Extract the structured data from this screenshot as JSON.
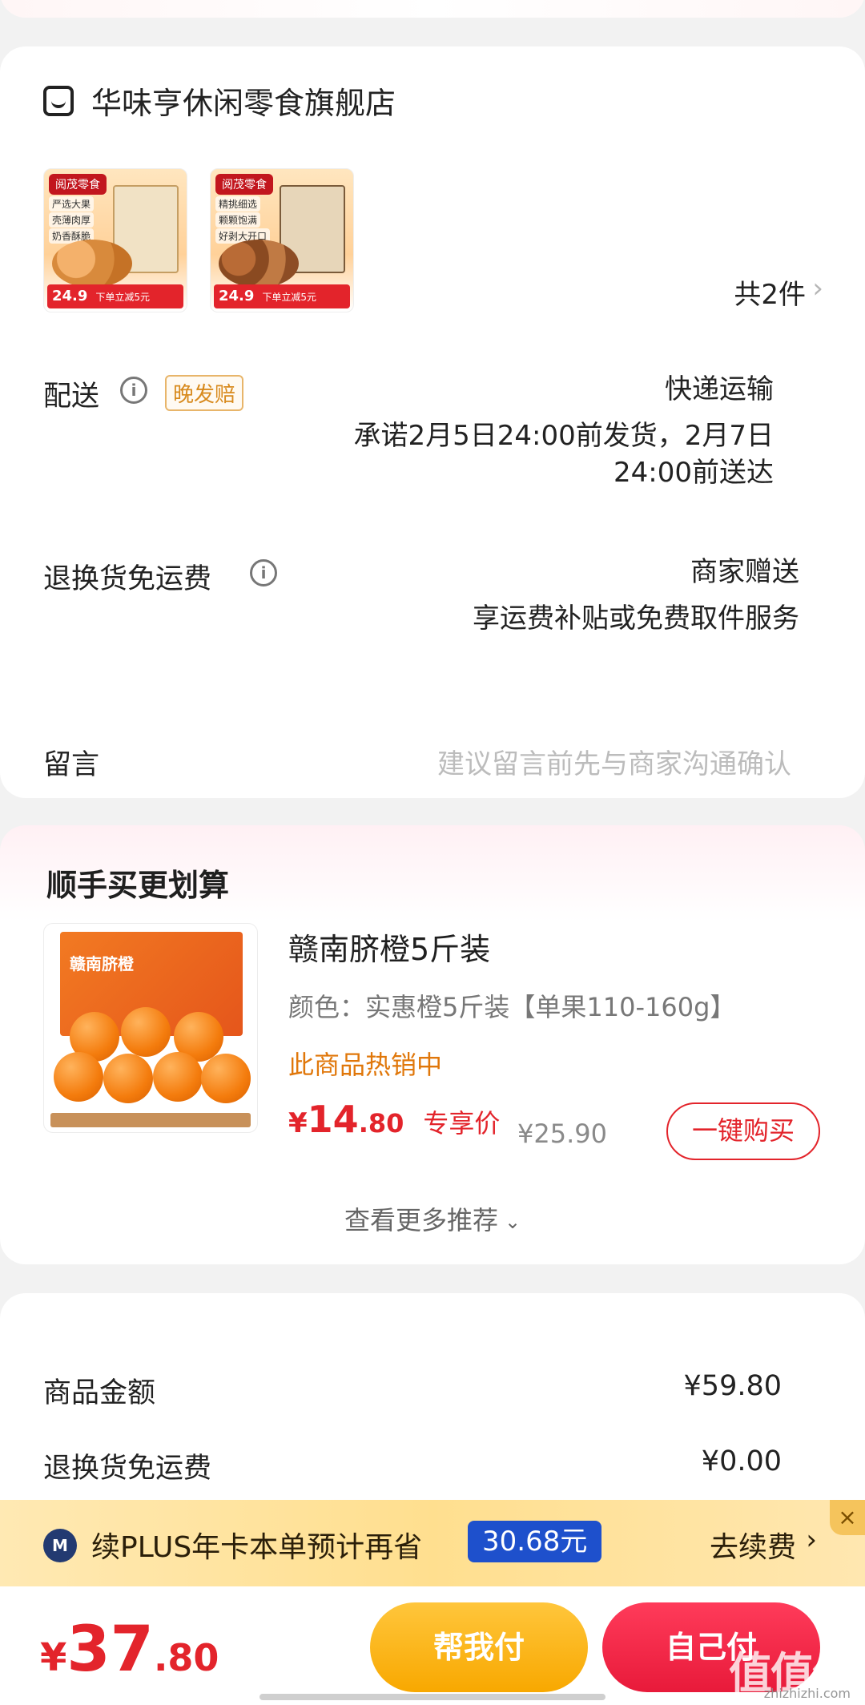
{
  "store": {
    "name": "华味亨休闲零食旗舰店",
    "items": [
      {
        "brand": "阅茂零食",
        "lines": [
          "严选大果",
          "壳薄肉厚",
          "奶香酥脆"
        ],
        "price": "24.9",
        "promo": "下单立减5元"
      },
      {
        "brand": "阅茂零食",
        "lines": [
          "精挑细选",
          "颗颗饱满",
          "好剥大开口"
        ],
        "price": "24.9",
        "promo": "下单立减5元"
      }
    ],
    "count_label": "共2件",
    "chevron": "›"
  },
  "delivery": {
    "label": "配送",
    "badge": "晚发赔",
    "method": "快递运输",
    "promise_line1": "承诺2月5日24:00前发货，2月7日",
    "promise_line2": "24:00前送达"
  },
  "return_free": {
    "label": "退换货免运费",
    "value_line1": "商家赠送",
    "value_line2": "享运费补贴或免费取件服务"
  },
  "message": {
    "label": "留言",
    "placeholder": "建议留言前先与商家沟通确认"
  },
  "recommend": {
    "title": "顺手买更划算",
    "product": {
      "name": "赣南脐橙5斤装",
      "box_label": "赣南脐橙",
      "spec": "颜色：实惠橙5斤装【单果110-160g】",
      "hot": "此商品热销中",
      "price_symbol": "¥",
      "price_int": "14",
      "price_dec": ".80",
      "price_tag": "专享价",
      "orig_price": "¥25.90",
      "buy_label": "一键购买"
    },
    "more_label": "查看更多推荐"
  },
  "summary": {
    "rows": [
      {
        "label": "商品金额",
        "value": "¥59.80"
      },
      {
        "label": "退换货免运费",
        "value": "¥0.00"
      }
    ]
  },
  "plus": {
    "logo": "M",
    "text": "续PLUS年卡本单预计再省",
    "amount": "30.68元",
    "action": "去续费",
    "chevron": "›",
    "close": "×"
  },
  "bottom": {
    "price_symbol": "¥",
    "price_int": "37",
    "price_dec": ".80",
    "help_pay": "帮我付",
    "self_pay": "自己付"
  },
  "watermark": {
    "text": "值值值",
    "url": "zhizhizhi.com"
  },
  "colors": {
    "accent_red": "#e3242b",
    "plus_blue": "#1e50cc",
    "warn_orange": "#e0770a"
  }
}
